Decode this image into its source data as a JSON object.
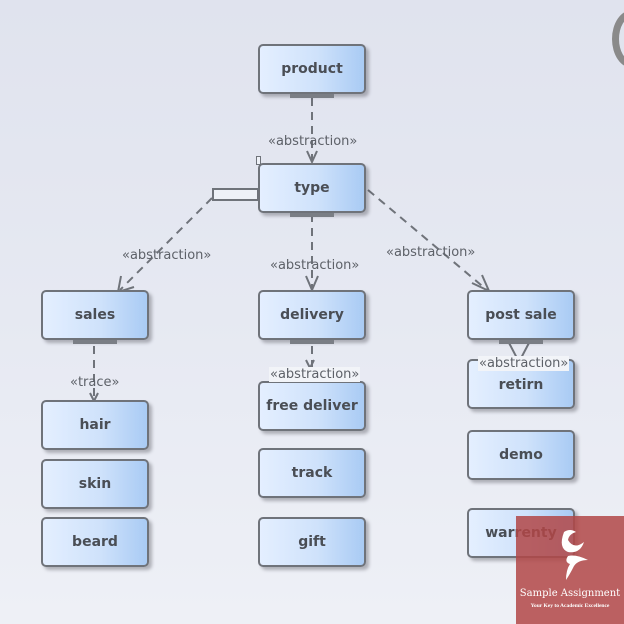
{
  "diagram": {
    "nodes": {
      "product": "product",
      "type": "type",
      "sales": "sales",
      "delivery": "delivery",
      "post_sale": "post sale",
      "hair": "hair",
      "skin": "skin",
      "beard": "beard",
      "free_deliver": "free deliver",
      "track": "track",
      "gift": "gift",
      "retirn": "retirn",
      "demo": "demo",
      "warrenty": "warrenty"
    },
    "edge_labels": {
      "product_type": "«abstraction»",
      "type_sales": "«abstraction»",
      "type_delivery": "«abstraction»",
      "type_post_sale": "«abstraction»",
      "sales_hair": "«trace»",
      "delivery_free_deliver": "«abstraction»",
      "post_sale_retirn": "«abstraction»"
    },
    "edges": [
      {
        "from": "product",
        "to": "type",
        "stereotype": "abstraction"
      },
      {
        "from": "type",
        "to": "sales",
        "stereotype": "abstraction"
      },
      {
        "from": "type",
        "to": "delivery",
        "stereotype": "abstraction"
      },
      {
        "from": "type",
        "to": "post sale",
        "stereotype": "abstraction"
      },
      {
        "from": "sales",
        "to": "hair",
        "stereotype": "trace"
      },
      {
        "from": "delivery",
        "to": "free deliver",
        "stereotype": "abstraction"
      },
      {
        "from": "post sale",
        "to": "retirn",
        "stereotype": "abstraction"
      }
    ]
  },
  "watermark": {
    "brand": "Sample Assignment",
    "tagline": "Your Key to Academic Excellence",
    "color": "#b24646"
  }
}
